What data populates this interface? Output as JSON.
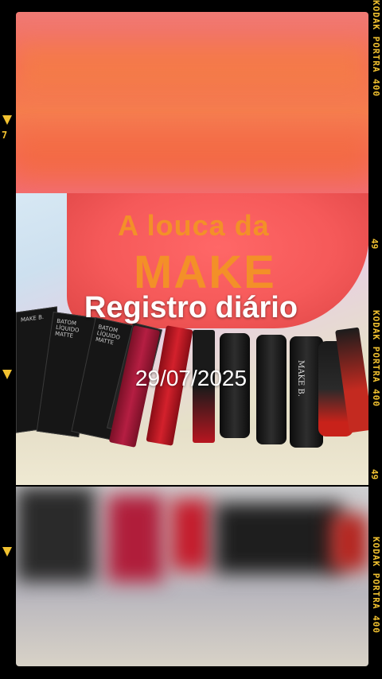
{
  "overlay": {
    "title": "Registro diário",
    "date": "29/07/2025"
  },
  "pouch": {
    "line1": "A louca da",
    "line2": "MAKE"
  },
  "film_strip": {
    "brand_text": "KODAK PORTRA 400",
    "frame_numbers": [
      "49",
      "49"
    ],
    "left_number": "7"
  },
  "product_labels": {
    "box_label": "MAKE B.",
    "box_subtitle": "BATOM LÍQUIDO MATTE",
    "lipstick_label": "MAKE B."
  }
}
